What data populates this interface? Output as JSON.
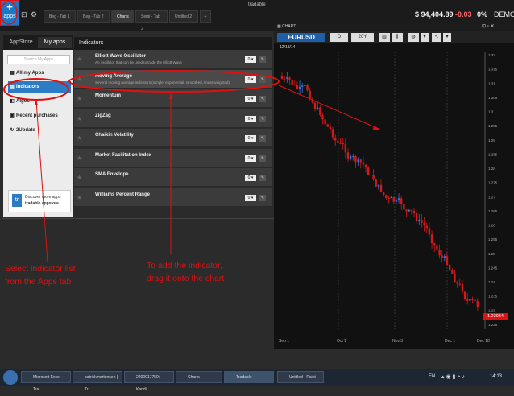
{
  "top_bar": {
    "apps_button_label": "apps",
    "tabs": [
      "Beg - Tab 1",
      "Beg - Tab 2",
      "Charts",
      "Semi - Tab 2",
      "Untitled 2"
    ],
    "add_tab": "+",
    "brand": "tradable",
    "balance": "$ 94,404.89",
    "pnl": "-0.03",
    "pct": "0%",
    "mode": "DEMO"
  },
  "apps_panel": {
    "tab_appstore": "AppStore",
    "tab_myapps": "My apps",
    "search_placeholder": "Search My Apps",
    "items": [
      {
        "label": "All my Apps",
        "icon": "grid-icon"
      },
      {
        "label": "Indicators",
        "icon": "chart-icon"
      },
      {
        "label": "Algos",
        "icon": "algo-icon"
      },
      {
        "label": "Recent purchases",
        "icon": "cart-icon"
      },
      {
        "label": "2Update",
        "icon": "refresh-icon"
      }
    ],
    "promo_line1": "Discover more apps",
    "promo_line2": "tradable appstore",
    "promo_logo": "tr"
  },
  "indicators": {
    "header": "Indicators",
    "items": [
      {
        "name": "Elliott Wave Oscillator",
        "desc": "An oscillator that can be used to trade the Elliott Wave",
        "count": "0"
      },
      {
        "name": "Moving Average",
        "desc": "Several moving average indicators (simple, exponential, smoothed, linear weighted)",
        "count": "0"
      },
      {
        "name": "Momentum",
        "desc": "",
        "count": "0"
      },
      {
        "name": "ZigZag",
        "desc": "",
        "count": "0"
      },
      {
        "name": "Chaikin Volatility",
        "desc": "",
        "count": "0"
      },
      {
        "name": "Market Facilitation Index",
        "desc": "",
        "count": "0"
      },
      {
        "name": "SMA Envelope",
        "desc": "",
        "count": "0"
      },
      {
        "name": "Williams Percent Range",
        "desc": "",
        "count": "0"
      }
    ]
  },
  "chart": {
    "window_title": "CHART",
    "symbol": "EURUSD",
    "timeframe": "D",
    "range": "20Y",
    "date_label": "12/18/14",
    "last_price": "1.22934",
    "price_ticks": [
      "1.32",
      "1.315",
      "1.31",
      "1.305",
      "1.3",
      "1.295",
      "1.29",
      "1.285",
      "1.28",
      "1.275",
      "1.27",
      "1.265",
      "1.26",
      "1.255",
      "1.25",
      "1.245",
      "1.24",
      "1.235",
      "1.23",
      "1.225"
    ],
    "date_ticks": [
      "Sep 1",
      "Oct 1",
      "Nov 3",
      "Dec 1",
      "Dec 18"
    ]
  },
  "annotations": {
    "left_line1": "Select indicator list",
    "left_line2": "from the Apps tab",
    "right_line1": "To add the indicator,",
    "right_line2": "drag it onto the chart"
  },
  "taskbar": {
    "items": [
      "Microsoft Excel - Tra...",
      "patrickmortensen | Tr...",
      "2200017750: Kandi...",
      "Charts",
      "Tradable",
      "Untitled - Paint"
    ],
    "lang": "EN",
    "clock": "14:13"
  },
  "colors": {
    "accent": "#2b7cc4",
    "annotation": "#e01010",
    "bear_candle": "#d11a1a",
    "bull_candle": "#3a6fd8"
  }
}
